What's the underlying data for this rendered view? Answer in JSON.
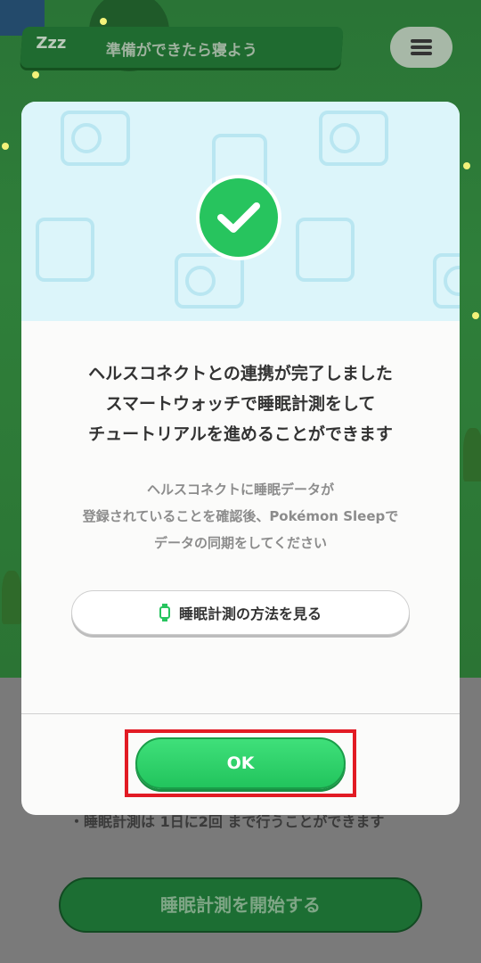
{
  "header": {
    "zzz": "Zzz",
    "title": "準備ができたら寝よう",
    "menu_icon": "hamburger-menu-icon"
  },
  "background": {
    "note": "・睡眠計測は 1日に2回 まで行うことができます",
    "start_button": "睡眠計測を開始する"
  },
  "modal": {
    "badge_icon": "checkmark-icon",
    "message_lines": [
      "ヘルスコネクトとの連携が完了しました",
      "スマートウォッチで睡眠計測をして",
      "チュートリアルを進めることができます"
    ],
    "sub_lines": [
      "ヘルスコネクトに睡眠データが",
      "登録されていることを確認後、Pokémon Sleepで",
      "データの同期をしてください"
    ],
    "howto_button": "睡眠計測の方法を見る",
    "howto_icon": "smartwatch-icon",
    "ok_button": "OK"
  },
  "colors": {
    "accent_green": "#27c45e",
    "highlight_red": "#e21b24",
    "hero_bg": "#dcf5fa"
  }
}
